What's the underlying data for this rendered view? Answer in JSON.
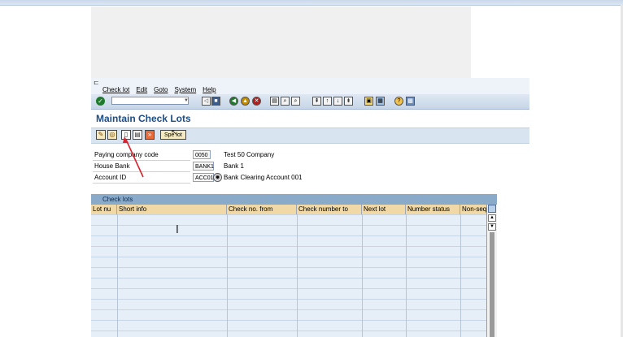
{
  "menu": {
    "glyph": "⊏",
    "items": [
      "Check lot",
      "Edit",
      "Goto",
      "System",
      "Help"
    ]
  },
  "toolbar": {
    "command_value": ""
  },
  "page": {
    "title": "Maintain Check Lots"
  },
  "app_toolbar": {
    "special_button_label": "Spe lot"
  },
  "fields": [
    {
      "label": "Paying company code",
      "value": "0050",
      "desc": "Test 50 Company"
    },
    {
      "label": "House Bank",
      "value": "BANK1",
      "desc": "Bank 1"
    },
    {
      "label": "Account ID",
      "value": "ACC01",
      "desc": "Bank Clearing Account 001"
    }
  ],
  "table": {
    "title": "Check lots",
    "columns": [
      "Lot nu",
      "Short info",
      "Check no. from",
      "Check number to",
      "Next lot",
      "Number status",
      "Non-seq"
    ]
  },
  "colors": {
    "title": "#1d4d85",
    "header_bg": "#f0d9a6",
    "table_title_bg": "#8aaac9",
    "annotation_arrow": "#d9232e"
  },
  "icons": {
    "ok": "checkmark-icon",
    "save": "save-icon",
    "back": "back-icon",
    "exit": "exit-icon",
    "cancel": "cancel-icon",
    "help": "help-icon"
  }
}
